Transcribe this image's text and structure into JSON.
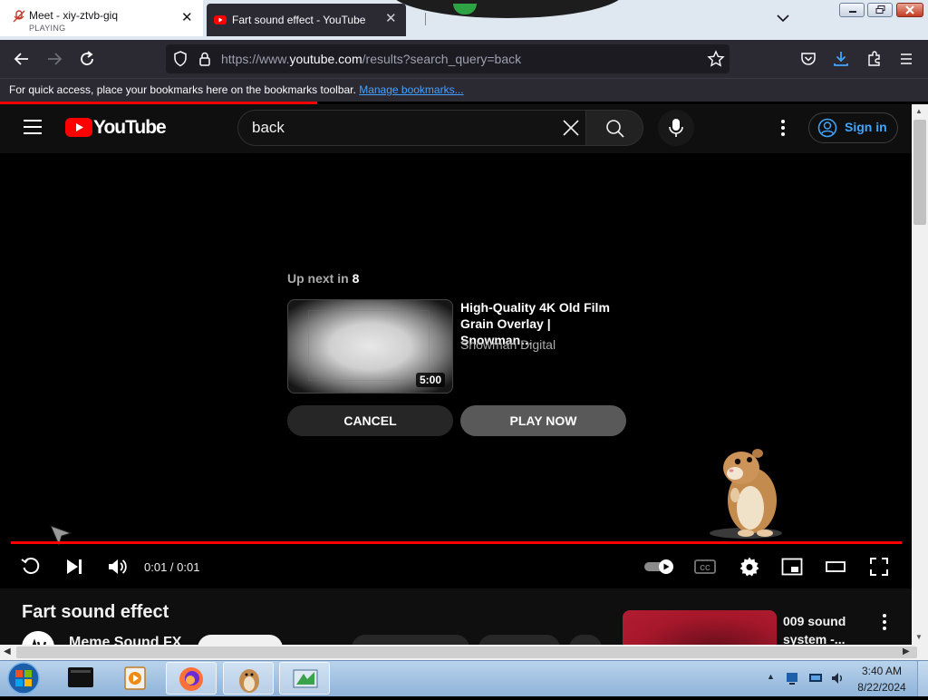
{
  "browser": {
    "tabs": [
      {
        "title": "Meet - xiy-ztvb-giq",
        "subtitle": "PLAYING",
        "active": false
      },
      {
        "title": "Fart sound effect - YouTube",
        "active": true
      }
    ],
    "close_glyph": "✕",
    "url": {
      "prefix": "https://www.",
      "host": "youtube.com",
      "path": "/results?search_query=back"
    },
    "bookmarks_bar": {
      "message": "For quick access, place your bookmarks here on the bookmarks toolbar.",
      "link": "Manage bookmarks..."
    }
  },
  "youtube": {
    "logo_text": "YouTube",
    "search": {
      "value": "back",
      "placeholder": "Search"
    },
    "sign_in_label": "Sign in",
    "accent_color": "#ff0000",
    "link_color": "#3ea6ff"
  },
  "player": {
    "up_next_label": "Up next in",
    "countdown": "8",
    "next_video": {
      "title": "High-Quality 4K Old Film Grain Overlay | Snowman…",
      "channel": "Snowman Digital",
      "duration": "5:00"
    },
    "cancel_label": "CANCEL",
    "play_now_label": "PLAY NOW",
    "time": "0:01 / 0:01",
    "progress": 1.0,
    "controls": [
      "replay-icon",
      "next-icon",
      "volume-icon",
      "autoplay-toggle",
      "captions-icon",
      "settings-icon",
      "miniplayer-icon",
      "theater-icon",
      "fullscreen-icon"
    ]
  },
  "below_player": {
    "video_title": "Fart sound effect",
    "channel_name": "Meme Sound FX",
    "related": {
      "title": "009 sound system -..."
    }
  },
  "taskbar": {
    "time": "3:40 AM",
    "date": "8/22/2024"
  }
}
